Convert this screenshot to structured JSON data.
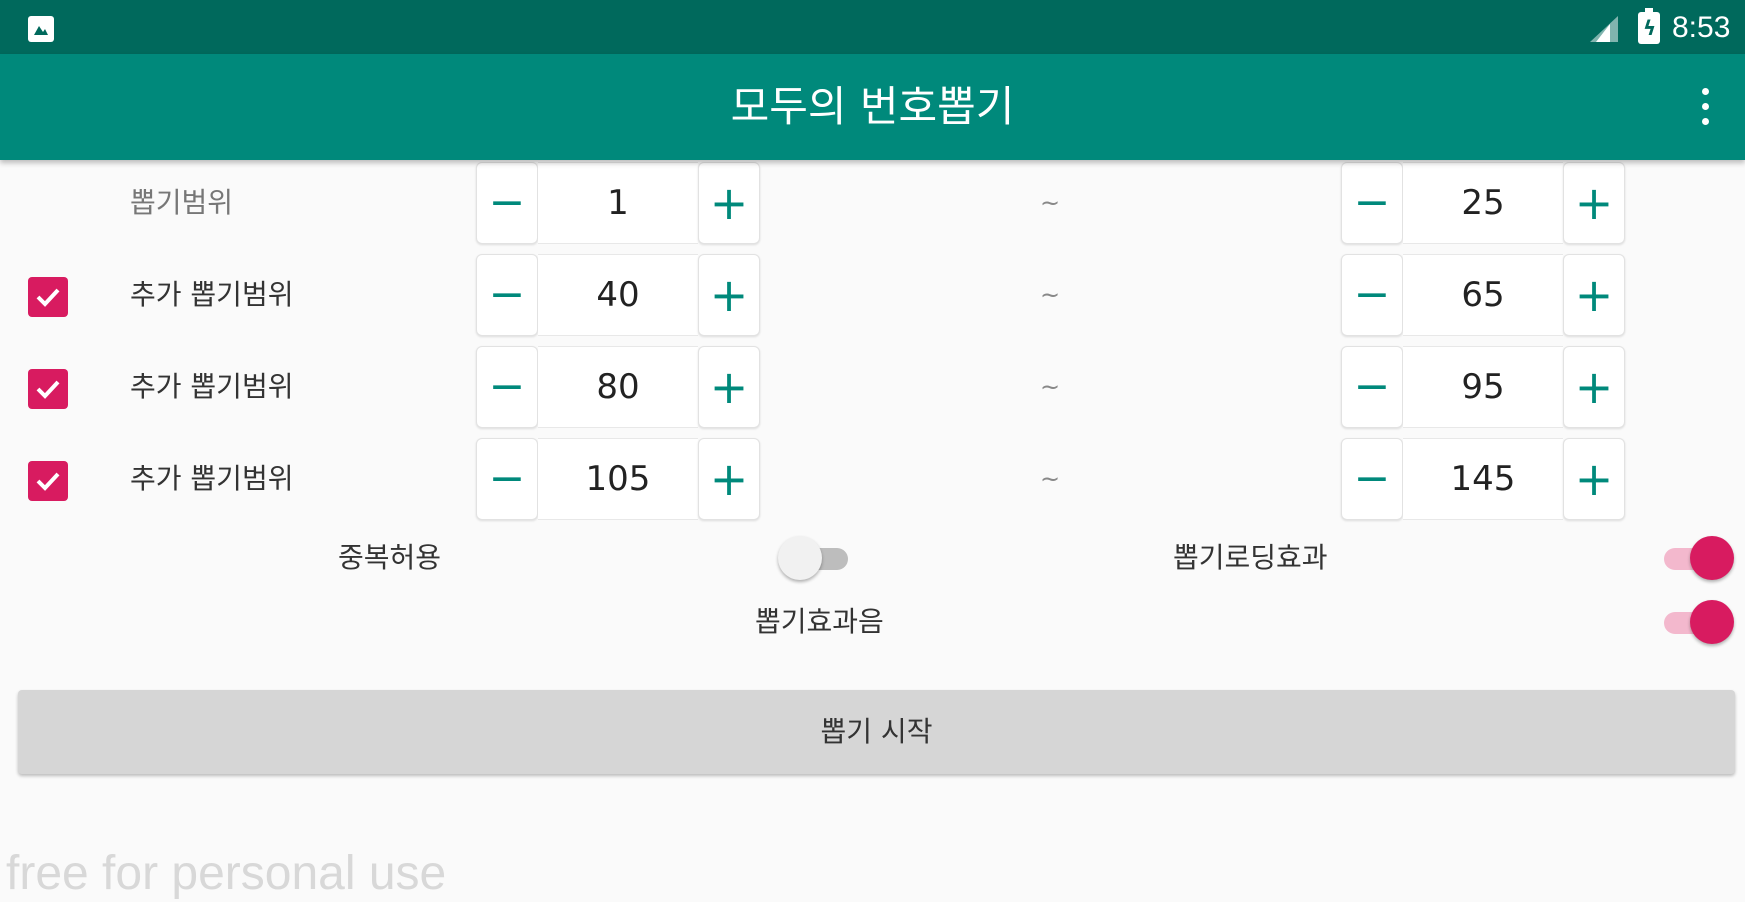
{
  "status_bar": {
    "time": "8:53",
    "app_icon": "photo-icon",
    "signal_icon": "signal-icon",
    "battery_icon": "battery-charging-icon"
  },
  "app_bar": {
    "title": "모두의 번호뽑기",
    "menu_icon": "more-vertical-icon"
  },
  "stepper_symbols": {
    "minus": "−",
    "plus": "+",
    "separator": "~"
  },
  "ranges": [
    {
      "label": "뽑기범위",
      "from": "1",
      "to": "25"
    },
    {
      "label": "추가 뽑기범위",
      "checked": true,
      "from": "40",
      "to": "65"
    },
    {
      "label": "추가 뽑기범위",
      "checked": true,
      "from": "80",
      "to": "95"
    },
    {
      "label": "추가 뽑기범위",
      "checked": true,
      "from": "105",
      "to": "145"
    }
  ],
  "options": {
    "allow_duplicates": {
      "label": "중복허용",
      "on": false
    },
    "loading_effect": {
      "label": "뽑기로딩효과",
      "on": true
    },
    "sound_effect": {
      "label": "뽑기효과음",
      "on": true
    }
  },
  "start_button": {
    "label": "뽑기 시작"
  },
  "watermark": "free for personal use",
  "colors": {
    "status_bar": "#00695c",
    "app_bar": "#00897b",
    "accent": "#d81b60",
    "stepper_icon": "#00897b"
  }
}
